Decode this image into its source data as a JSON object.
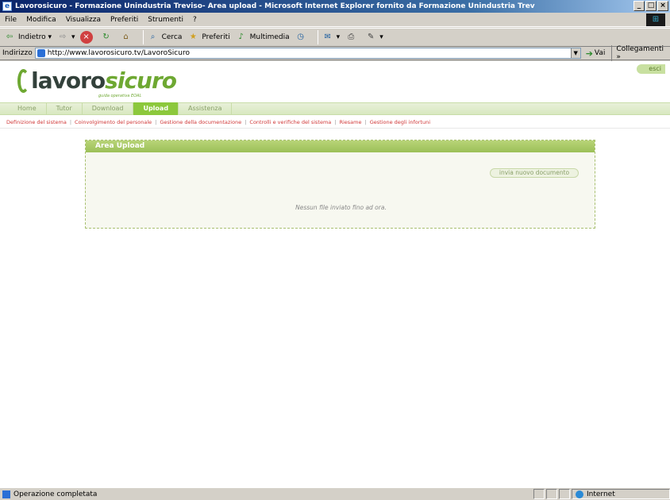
{
  "window": {
    "title": "Lavorosicuro - Formazione Unindustria Treviso- Area upload - Microsoft Internet Explorer fornito da Formazione Unindustria Trev"
  },
  "menu": {
    "items": [
      "File",
      "Modifica",
      "Visualizza",
      "Preferiti",
      "Strumenti",
      "?"
    ]
  },
  "toolbar": {
    "back": "Indietro",
    "search": "Cerca",
    "favorites": "Preferiti",
    "multimedia": "Multimedia"
  },
  "address": {
    "label": "Indirizzo",
    "url": "http://www.lavorosicuro.tv/LavoroSicuro",
    "go": "Vai",
    "links": "Collegamenti"
  },
  "site": {
    "exit": "esci",
    "logo_main": "lavoro",
    "logo_accent": "sicuro",
    "logo_tagline": "guida operativa EOAL",
    "nav": [
      "Home",
      "Tutor",
      "Download",
      "Upload",
      "Assistenza"
    ],
    "nav_active": "Upload",
    "subnav": [
      "Definizione del sistema",
      "Coinvolgimento del personale",
      "Gestione della documentazione",
      "Controlli e verifiche del sistema",
      "Riesame",
      "Gestione degli infortuni"
    ]
  },
  "upload": {
    "title": "Area Upload",
    "button": "invia nuovo documento",
    "empty": "Nessun file inviato fino ad ora."
  },
  "status": {
    "text": "Operazione completata",
    "zone": "Internet"
  },
  "colors": {
    "accent": "#8cc83c",
    "link": "#d03838",
    "titlebar": "#0a246a"
  }
}
